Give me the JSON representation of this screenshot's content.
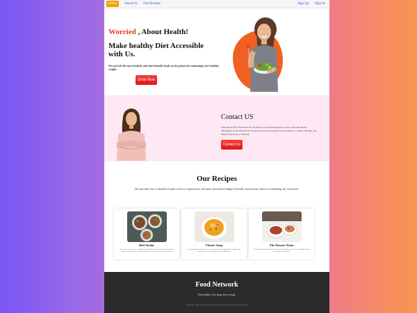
{
  "nav": {
    "home": "Home",
    "about": "About Us",
    "recipes": "Our Recipes",
    "signup": "Sign Up",
    "signin": "Sign In"
  },
  "hero": {
    "title_highlight": "Worried",
    "title_rest": " , About Health!",
    "subtitle": "Make healthy Diet Accessible with Us.",
    "description": "We provide the most healthy and diet-friendly foods on the planet for maintaing your healthy weight.",
    "cta": "Order Now"
  },
  "contact": {
    "title": "Contact US",
    "description": "Welcome to Food Network! For quality food, exceptional prices, and a clean and superb atmosphere. Food Network is second to none. If you prefer foods at home, we offer a full take-out menu for pick-up or delivery.",
    "cta": "Contact Us"
  },
  "recipes": {
    "title": "Our Recipes",
    "description": "We provide lots of health recipes such as vegetarian, chicken, and other budget-friendly food items, there's something for everyone.",
    "cards": [
      {
        "name": "Beef Steaks",
        "text": "Beef steak, lean protein, vegetables and mushrooms cooked to perfection. Our chefs recommend it for every healthy eater. A meal for the whole family."
      },
      {
        "name": "Cheese Soup",
        "text": "A creamy and smooth cheese soup made with fresh ingredients, topped with herbs. Perfect for cold days and a healthy treat."
      },
      {
        "name": "The Dessert Train",
        "text": "A healthy dessert made from fresh fruits and light cream. A sweet ending that you can enjoy without guilt."
      }
    ]
  },
  "footer": {
    "brand": "Food Network",
    "tagline": "Eat healthy, live long, live strong.",
    "copyright": "Copyright © 2022 All rights reserved by Food Network. Made by Food Network Team."
  },
  "colors": {
    "accent": "#e53a12",
    "button": "#e82222",
    "contact_bg": "#fde8f3",
    "footer_bg": "#2b2b2b"
  }
}
